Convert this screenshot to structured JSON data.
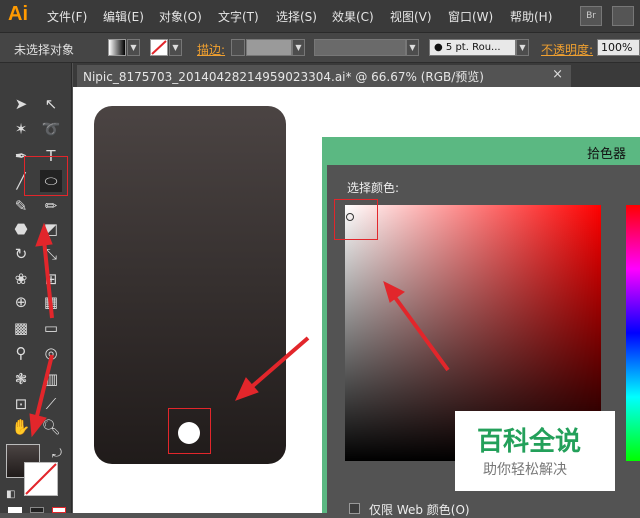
{
  "app": {
    "logo": "Ai"
  },
  "menu": [
    "文件(F)",
    "编辑(E)",
    "对象(O)",
    "文字(T)",
    "选择(S)",
    "效果(C)",
    "视图(V)",
    "窗口(W)",
    "帮助(H)"
  ],
  "top_buttons": {
    "bridge": "Br"
  },
  "control_bar": {
    "selection_status": "未选择对象",
    "stroke_label": "描边:",
    "brush_value": "5 pt. Rou...",
    "opacity_label": "不透明度:",
    "opacity_value": "100%"
  },
  "document_tab": {
    "title": "Nipic_8175703_20140428214959023304.ai* @ 66.67% (RGB/预览)",
    "close": "×"
  },
  "color_picker": {
    "title": "拾色器",
    "select_color_label": "选择颜色:",
    "web_only_label": "仅限 Web 颜色(O)",
    "selected_color": "#ffffff",
    "accent": "#5bb882"
  },
  "watermark": {
    "title": "百科全说",
    "subtitle": "助你轻松解决"
  },
  "colors": {
    "annotation_red": "#e2262b",
    "phone_top": "#4b4443",
    "phone_bottom": "#201b1a"
  }
}
